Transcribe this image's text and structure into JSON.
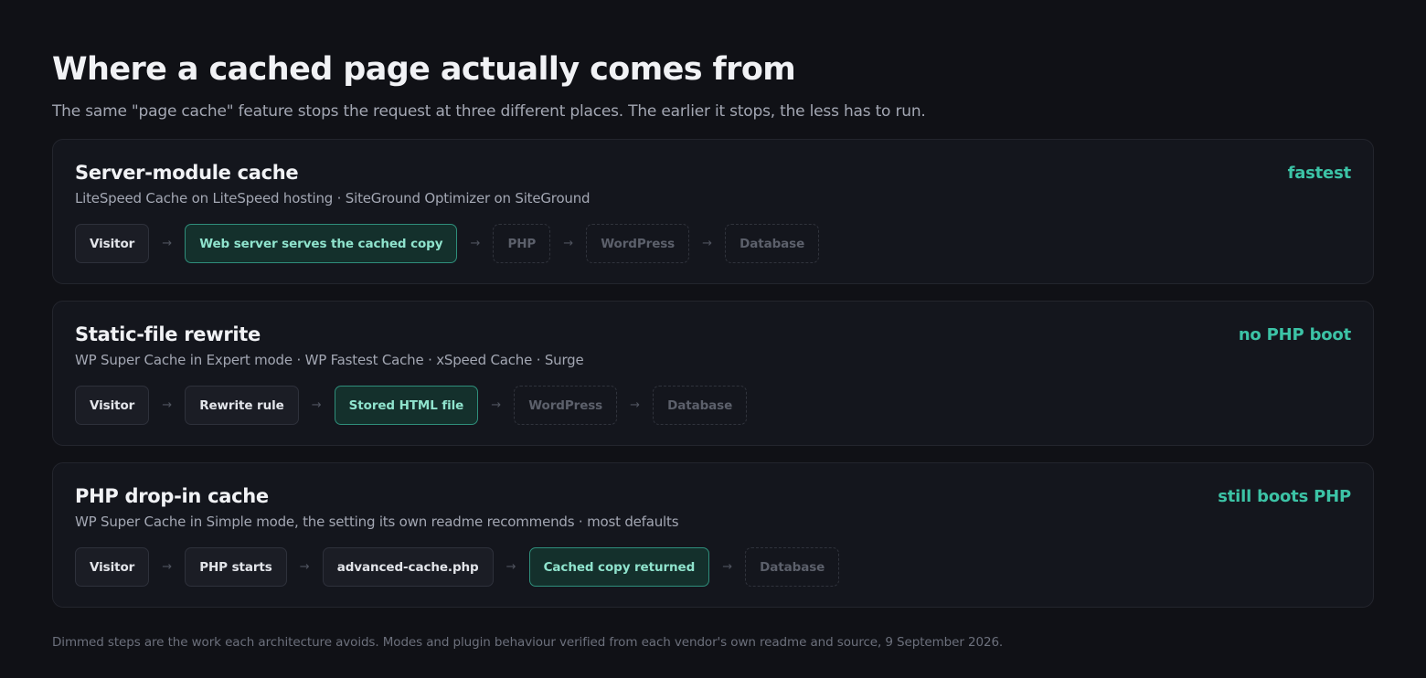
{
  "header": {
    "title": "Where a cached page actually comes from",
    "subtitle": "The same \"page cache\" feature stops the request at three different places. The earlier it stops, the less has to run."
  },
  "cards": [
    {
      "title": "Server-module cache",
      "tag": "fastest",
      "description": "LiteSpeed Cache on LiteSpeed hosting · SiteGround Optimizer on SiteGround",
      "steps": [
        {
          "label": "Visitor",
          "state": "normal"
        },
        {
          "label": "Web server serves the cached copy",
          "state": "served"
        },
        {
          "label": "PHP",
          "state": "dimmed"
        },
        {
          "label": "WordPress",
          "state": "dimmed"
        },
        {
          "label": "Database",
          "state": "dimmed"
        }
      ]
    },
    {
      "title": "Static-file rewrite",
      "tag": "no PHP boot",
      "description": "WP Super Cache in Expert mode · WP Fastest Cache · xSpeed Cache · Surge",
      "steps": [
        {
          "label": "Visitor",
          "state": "normal"
        },
        {
          "label": "Rewrite rule",
          "state": "normal"
        },
        {
          "label": "Stored HTML file",
          "state": "served"
        },
        {
          "label": "WordPress",
          "state": "dimmed"
        },
        {
          "label": "Database",
          "state": "dimmed"
        }
      ]
    },
    {
      "title": "PHP drop-in cache",
      "tag": "still boots PHP",
      "description": "WP Super Cache in Simple mode, the setting its own readme recommends · most defaults",
      "steps": [
        {
          "label": "Visitor",
          "state": "normal"
        },
        {
          "label": "PHP starts",
          "state": "normal"
        },
        {
          "label": "advanced-cache.php",
          "state": "normal"
        },
        {
          "label": "Cached copy returned",
          "state": "served"
        },
        {
          "label": "Database",
          "state": "dimmed"
        }
      ]
    }
  ],
  "arrow_glyph": "→",
  "footnote": "Dimmed steps are the work each architecture avoids. Modes and plugin behaviour verified from each vendor's own readme and source, 9 September 2026.",
  "colors": {
    "background": "#101116",
    "card": "#14161d",
    "accent": "#3cc3a6",
    "served_fill": "#14302c",
    "served_border": "#2f8e7b"
  }
}
